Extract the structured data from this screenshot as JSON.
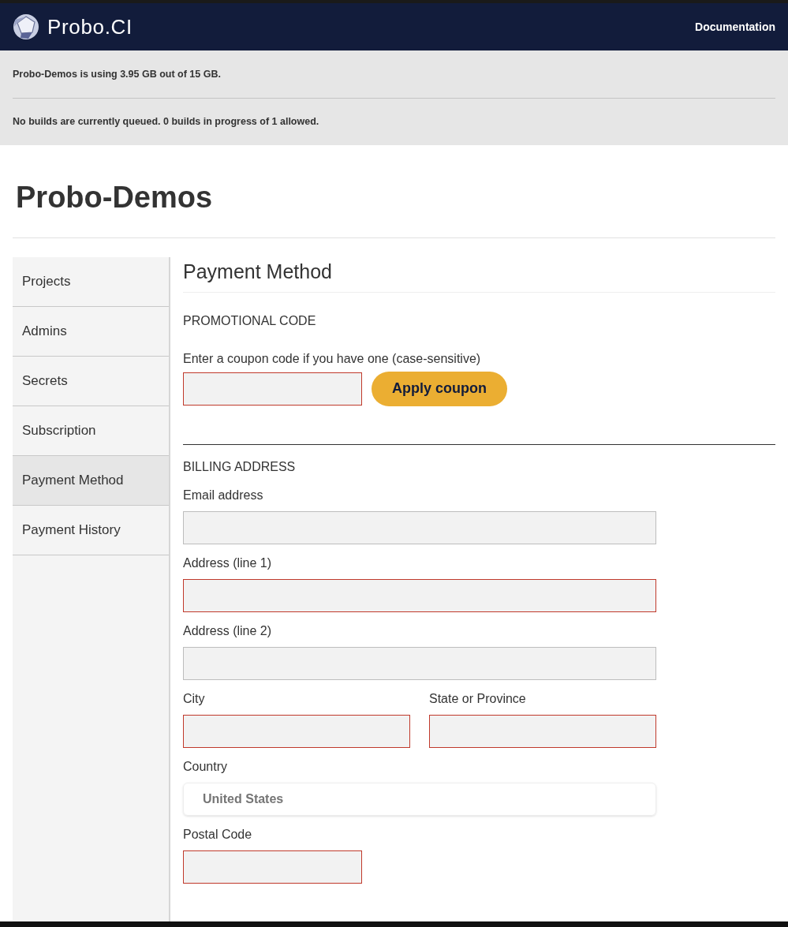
{
  "header": {
    "brand": "Probo.CI",
    "nav_link": "Documentation"
  },
  "notices": [
    "Probo-Demos is using 3.95 GB out of 15 GB.",
    "No builds are currently queued. 0 builds in progress of 1 allowed."
  ],
  "page_title": "Probo-Demos",
  "sidebar": {
    "items": [
      {
        "label": "Projects",
        "selected": false
      },
      {
        "label": "Admins",
        "selected": false
      },
      {
        "label": "Secrets",
        "selected": false
      },
      {
        "label": "Subscription",
        "selected": false
      },
      {
        "label": "Payment Method",
        "selected": true
      },
      {
        "label": "Payment History",
        "selected": false
      }
    ]
  },
  "section_title": "Payment Method",
  "promo": {
    "heading": "PROMOTIONAL CODE",
    "label": "Enter a coupon code if you have one (case-sensitive)",
    "invalid": true,
    "button": "Apply coupon"
  },
  "billing": {
    "heading": "BILLING ADDRESS",
    "rows": [
      [
        {
          "kind": "input",
          "label": "Email address",
          "invalid": false
        }
      ],
      [
        {
          "kind": "input",
          "label": "Address (line 1)",
          "invalid": true
        }
      ],
      [
        {
          "kind": "input",
          "label": "Address (line 2)",
          "invalid": false
        }
      ],
      [
        {
          "kind": "input",
          "label": "City",
          "invalid": true
        },
        {
          "kind": "input",
          "label": "State or Province",
          "invalid": true
        }
      ],
      [
        {
          "kind": "select",
          "label": "Country",
          "value": "United States"
        }
      ],
      [
        {
          "kind": "input",
          "label": "Postal Code",
          "invalid": true,
          "short": true
        }
      ]
    ]
  }
}
